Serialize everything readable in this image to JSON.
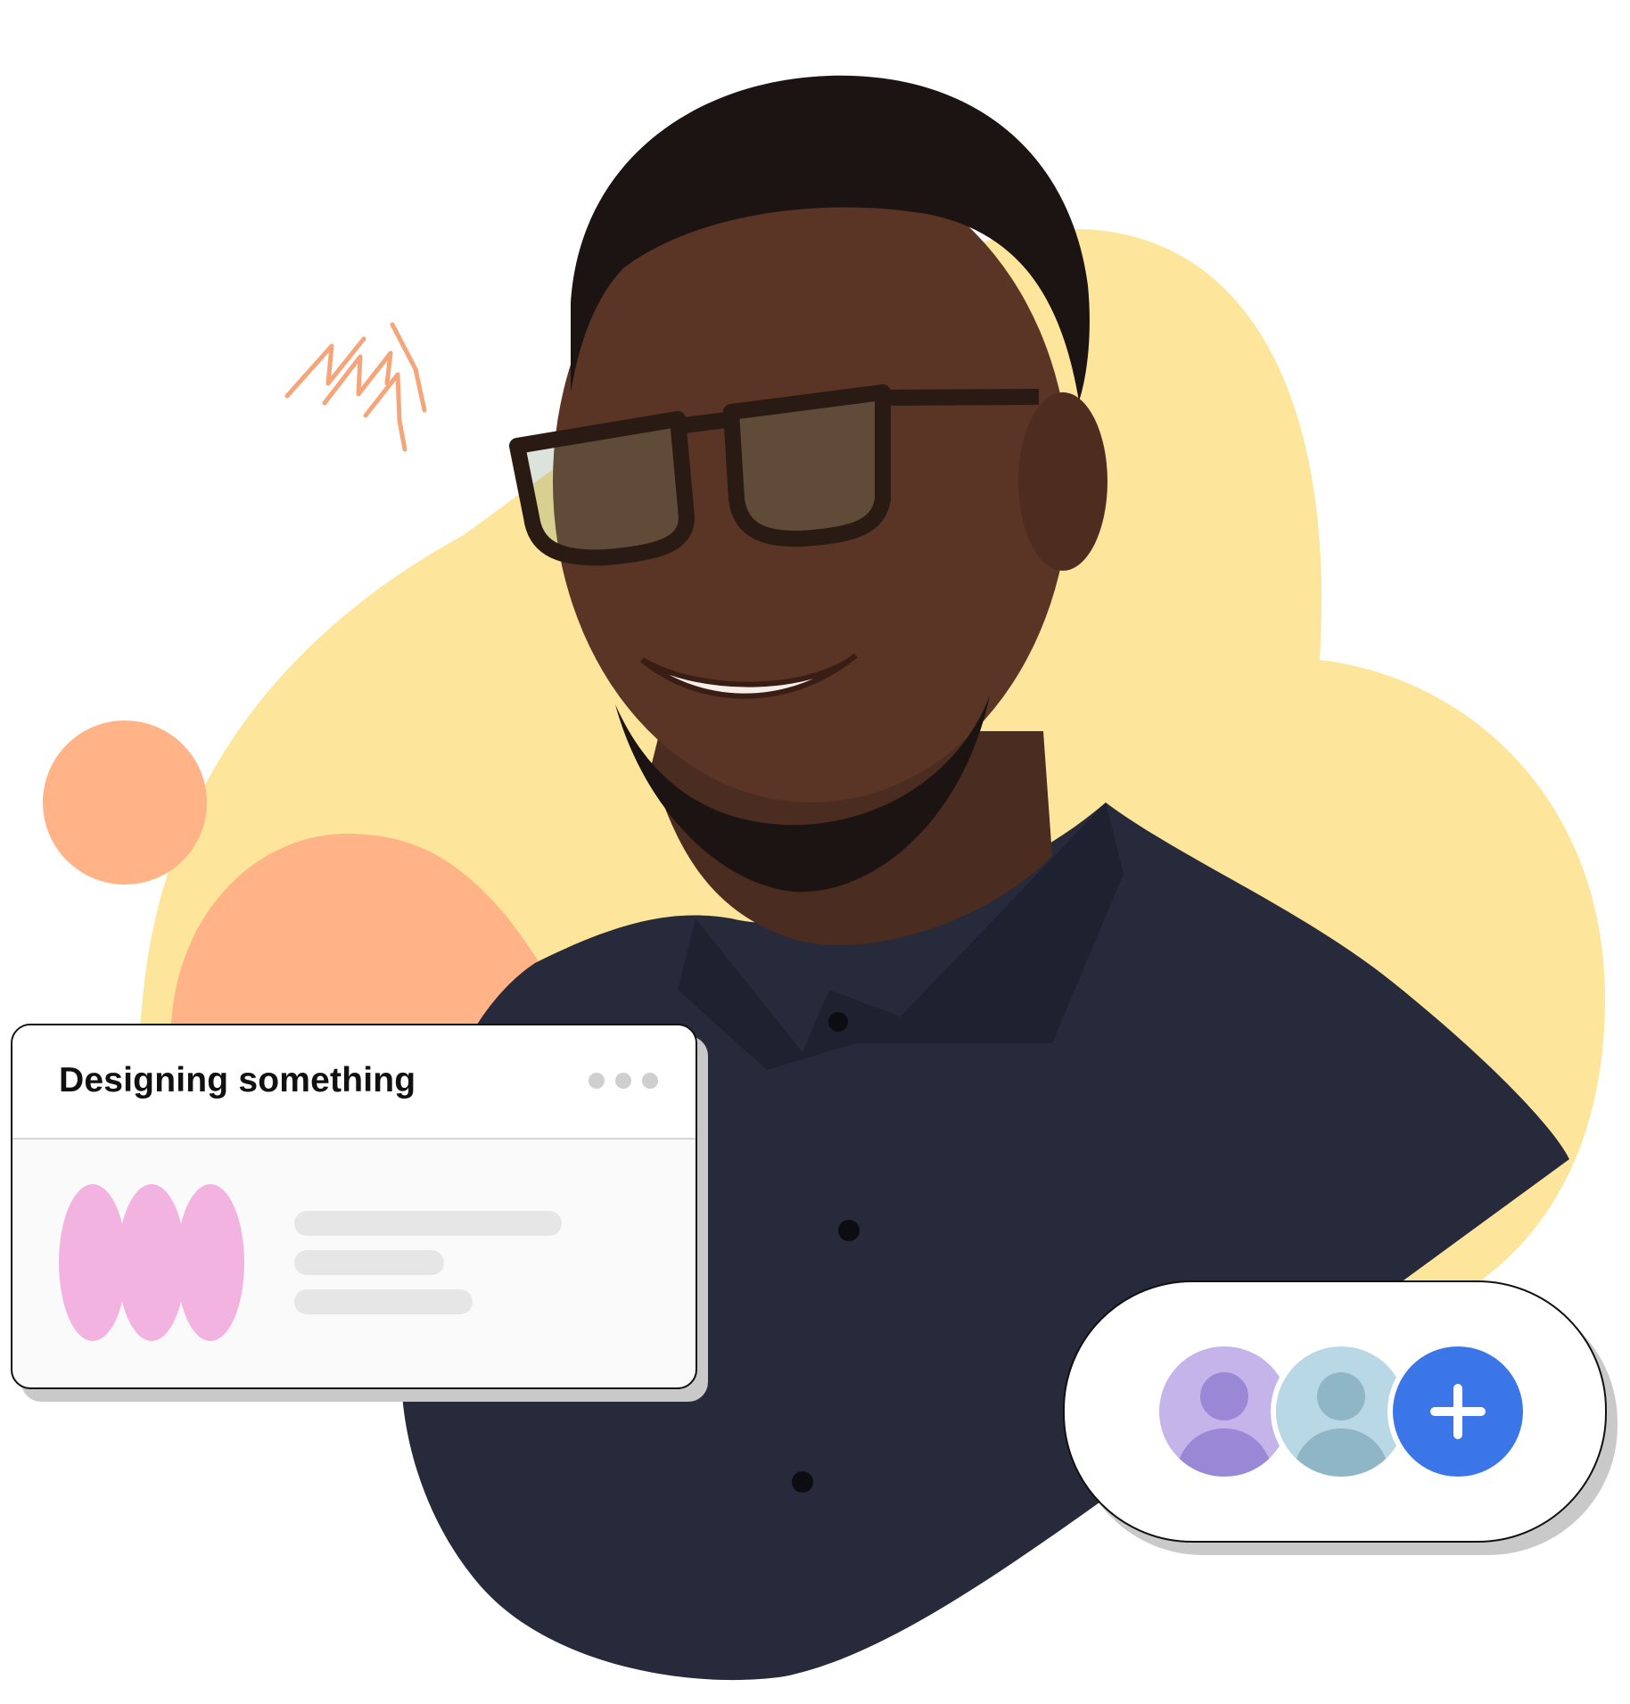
{
  "card": {
    "title": "Designing something"
  },
  "icons": {
    "more": "ellipsis-icon",
    "add": "plus-icon",
    "user": "user-icon",
    "sparkle": "zigzag-icon"
  },
  "colors": {
    "yellow_blob": "#fde59c",
    "peach": "#ffb386",
    "pink": "#f2b3e0",
    "purple_avatar_bg": "#c4b4ea",
    "purple_avatar_fg": "#9a88d6",
    "blue_avatar_bg": "#b9d8e6",
    "blue_avatar_fg": "#8fb6c6",
    "primary": "#3b76e8",
    "shirt": "#262a3a"
  }
}
